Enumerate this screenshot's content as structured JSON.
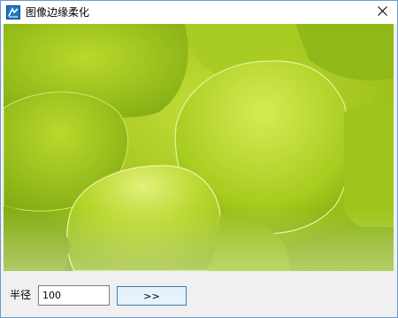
{
  "window": {
    "title": "图像边缘柔化",
    "app_icon": "app-logo-icon",
    "close_icon": "close-icon"
  },
  "image": {
    "description_icon": "succulent-photo"
  },
  "controls": {
    "radius_label": "半径",
    "radius_value": "100",
    "next_button_label": ">>"
  },
  "colors": {
    "accent": "#3c7fb1",
    "button_bg": "#e5f1fb",
    "window_border": "#6a9ad1"
  }
}
